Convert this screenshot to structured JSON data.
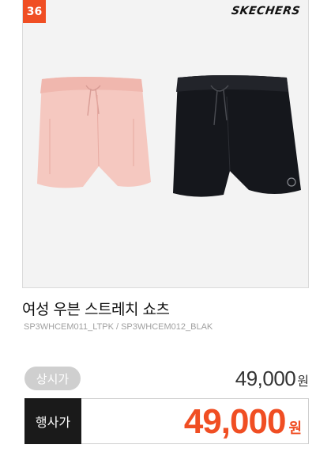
{
  "product": {
    "rank": "36",
    "brand": "SKECHERS",
    "name": "여성 우븐 스트레치 쇼츠",
    "code": "SP3WHCEM011_LTPK / SP3WHCEM012_BLAK",
    "image_icon": "shorts-image",
    "colors": {
      "pink": "#f5c8c0",
      "black": "#15171c",
      "accent": "#f04e23"
    }
  },
  "price": {
    "regular_label": "상시가",
    "regular_value": "49,000",
    "regular_unit": "원",
    "sale_label": "행사가",
    "sale_value": "49,000",
    "sale_unit": "원"
  }
}
